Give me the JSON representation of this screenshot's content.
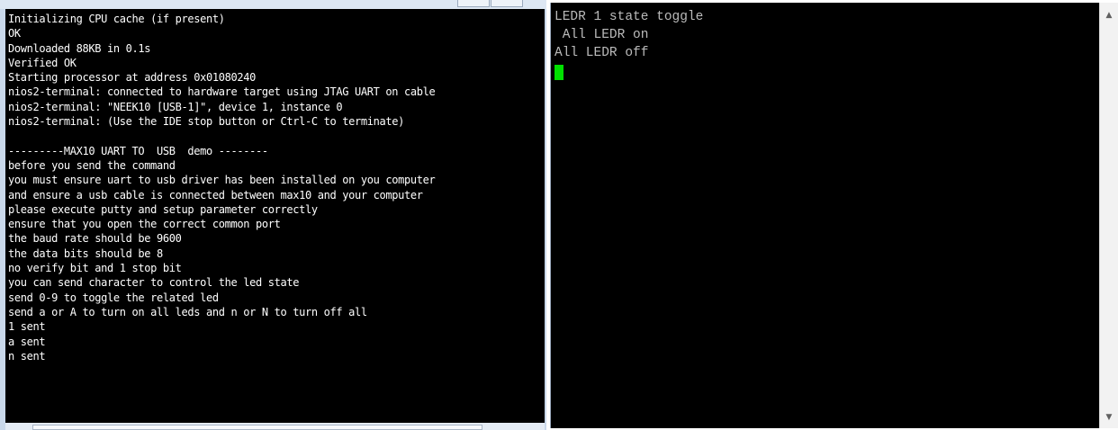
{
  "left_terminal": {
    "lines": [
      "Initializing CPU cache (if present)",
      "OK",
      "Downloaded 88KB in 0.1s",
      "Verified OK",
      "Starting processor at address 0x01080240",
      "nios2-terminal: connected to hardware target using JTAG UART on cable",
      "nios2-terminal: \"NEEK10 [USB-1]\", device 1, instance 0",
      "nios2-terminal: (Use the IDE stop button or Ctrl-C to terminate)",
      "",
      "---------MAX10 UART TO  USB  demo --------",
      "before you send the command",
      "you must ensure uart to usb driver has been installed on you computer",
      "and ensure a usb cable is connected between max10 and your computer",
      "please execute putty and setup parameter correctly",
      "ensure that you open the correct common port",
      "the baud rate should be 9600",
      "the data bits should be 8",
      "no verify bit and 1 stop bit",
      "you can send character to control the led state",
      "send 0-9 to toggle the related led",
      "send a or A to turn on all leds and n or N to turn off all",
      "1 sent",
      "a sent",
      "n sent"
    ]
  },
  "right_terminal": {
    "lines": [
      "LEDR 1 state toggle",
      " All LEDR on",
      "All LEDR off"
    ],
    "cursor_color": "#00e000"
  },
  "scrollbar": {
    "up_arrow": "▲",
    "down_arrow": "▼"
  },
  "colors": {
    "terminal_bg": "#000000",
    "left_text": "#ffffff",
    "right_text": "#bbbbbb"
  }
}
